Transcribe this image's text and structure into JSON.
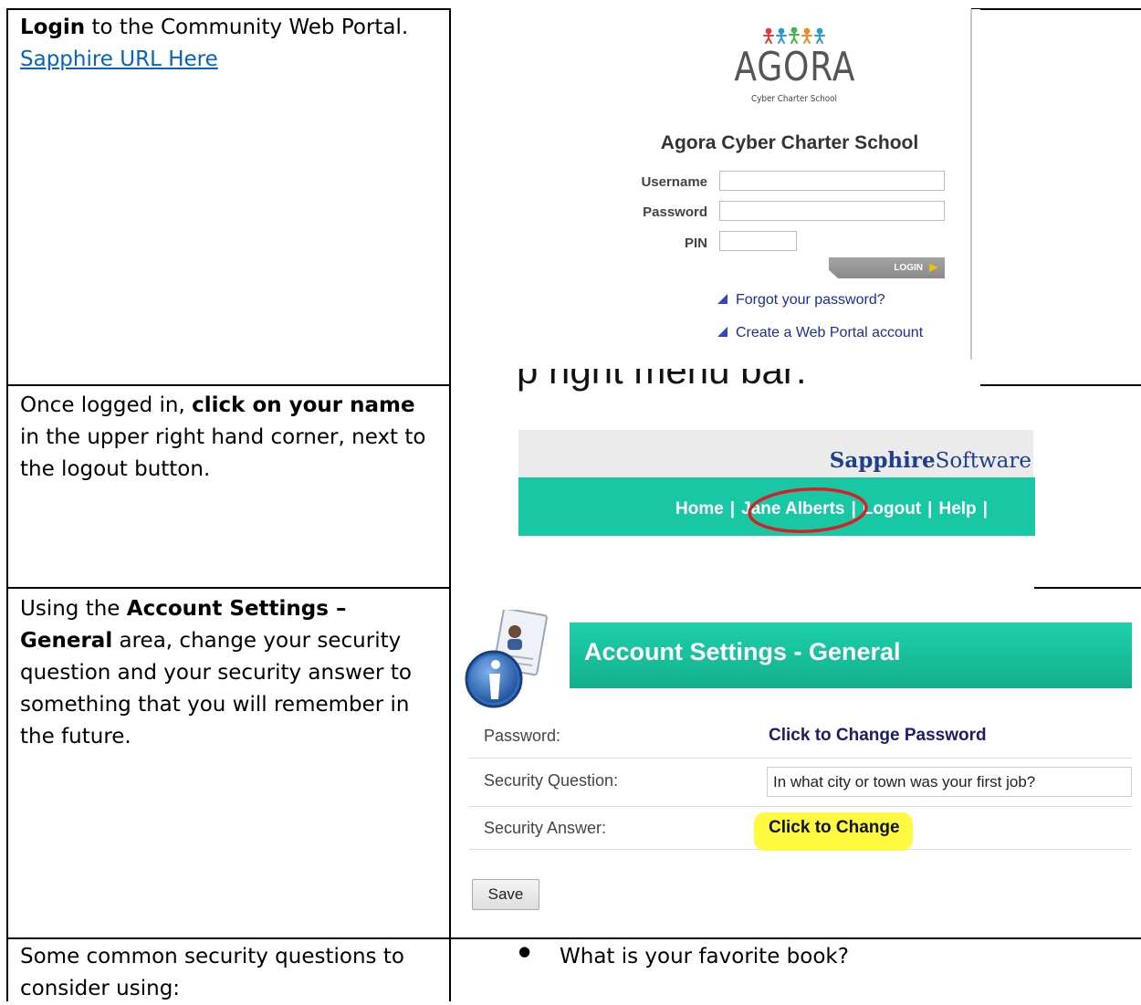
{
  "rows": [
    {
      "text_bold": "Login",
      "text_rest": " to the Community Web Portal.",
      "link": "Sapphire URL Here"
    },
    {
      "text_before": "Once logged in, ",
      "text_bold": "click on your name",
      "text_after": " in the upper right hand corner, next to the logout button."
    },
    {
      "text_before": "Using the ",
      "text_bold": "Account Settings – General",
      "text_after": " area, change your security question and your security answer to something that you will remember in the future."
    },
    {
      "text": "Some common security questions to consider using:",
      "bullet": "What is your favorite book?"
    }
  ],
  "login_screen": {
    "logo_text": "AGORA",
    "logo_sub": "Cyber Charter School",
    "school_name": "Agora Cyber Charter School",
    "username_label": "Username",
    "password_label": "Password",
    "pin_label": "PIN",
    "login_button": "LOGIN",
    "forgot_link": "Forgot your password?",
    "create_link": "Create a Web Portal account"
  },
  "menu_screen": {
    "partial_heading": "p right menu bar:",
    "logo_bold": "Sapphire",
    "logo_rest": "Software",
    "menu_items": [
      "Home",
      "Jane Alberts",
      "Logout",
      "Help"
    ]
  },
  "account_screen": {
    "title": "Account Settings - General",
    "password_label": "Password:",
    "password_link": "Click to Change Password",
    "question_label": "Security Question:",
    "question_value": "In what city or town was your first job?",
    "answer_label": "Security Answer:",
    "answer_link": "Click to Change",
    "save_button": "Save",
    "highlight_color": "#fffa36",
    "banner_color": "#18c7a4"
  }
}
